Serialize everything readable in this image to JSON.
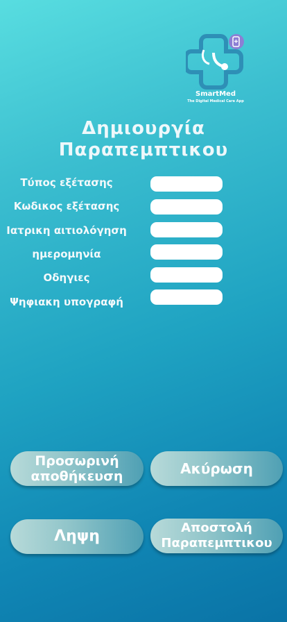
{
  "logo": {
    "name": "SmartMed",
    "tagline": "The Digital Medical Care App"
  },
  "title": {
    "line1": "Δημιουργία",
    "line2": "Παραπεμπτικου"
  },
  "form": {
    "fields": [
      {
        "label": "Τύπος εξέτασης",
        "value": ""
      },
      {
        "label": "Κωδικος εξέτασης",
        "value": ""
      },
      {
        "label": "Ιατρικη αιτιολόγηση",
        "value": ""
      },
      {
        "label": "ημερομηνία",
        "value": ""
      },
      {
        "label": "Οδηγιες",
        "value": ""
      },
      {
        "label": "Ψηφιακη υπογραφή",
        "value": ""
      }
    ]
  },
  "buttons": {
    "temp_save_line1": "Προσωρινή",
    "temp_save_line2": "αποθήκευση",
    "cancel": "Ακύρωση",
    "download": "Ληψη",
    "send_line1": "Αποστολή",
    "send_line2": "Παραπεμπτικου"
  },
  "colors": {
    "background_top": "#58dde0",
    "background_bottom": "#0a73a6",
    "button_light": "#b7dad9",
    "button_dark": "#4fa0b4",
    "logo_badge": "#8b7fd4"
  },
  "icons": {
    "logo_mark": "medical-cross-stethoscope-logo",
    "logo_badge": "phone-hospital-icon"
  }
}
